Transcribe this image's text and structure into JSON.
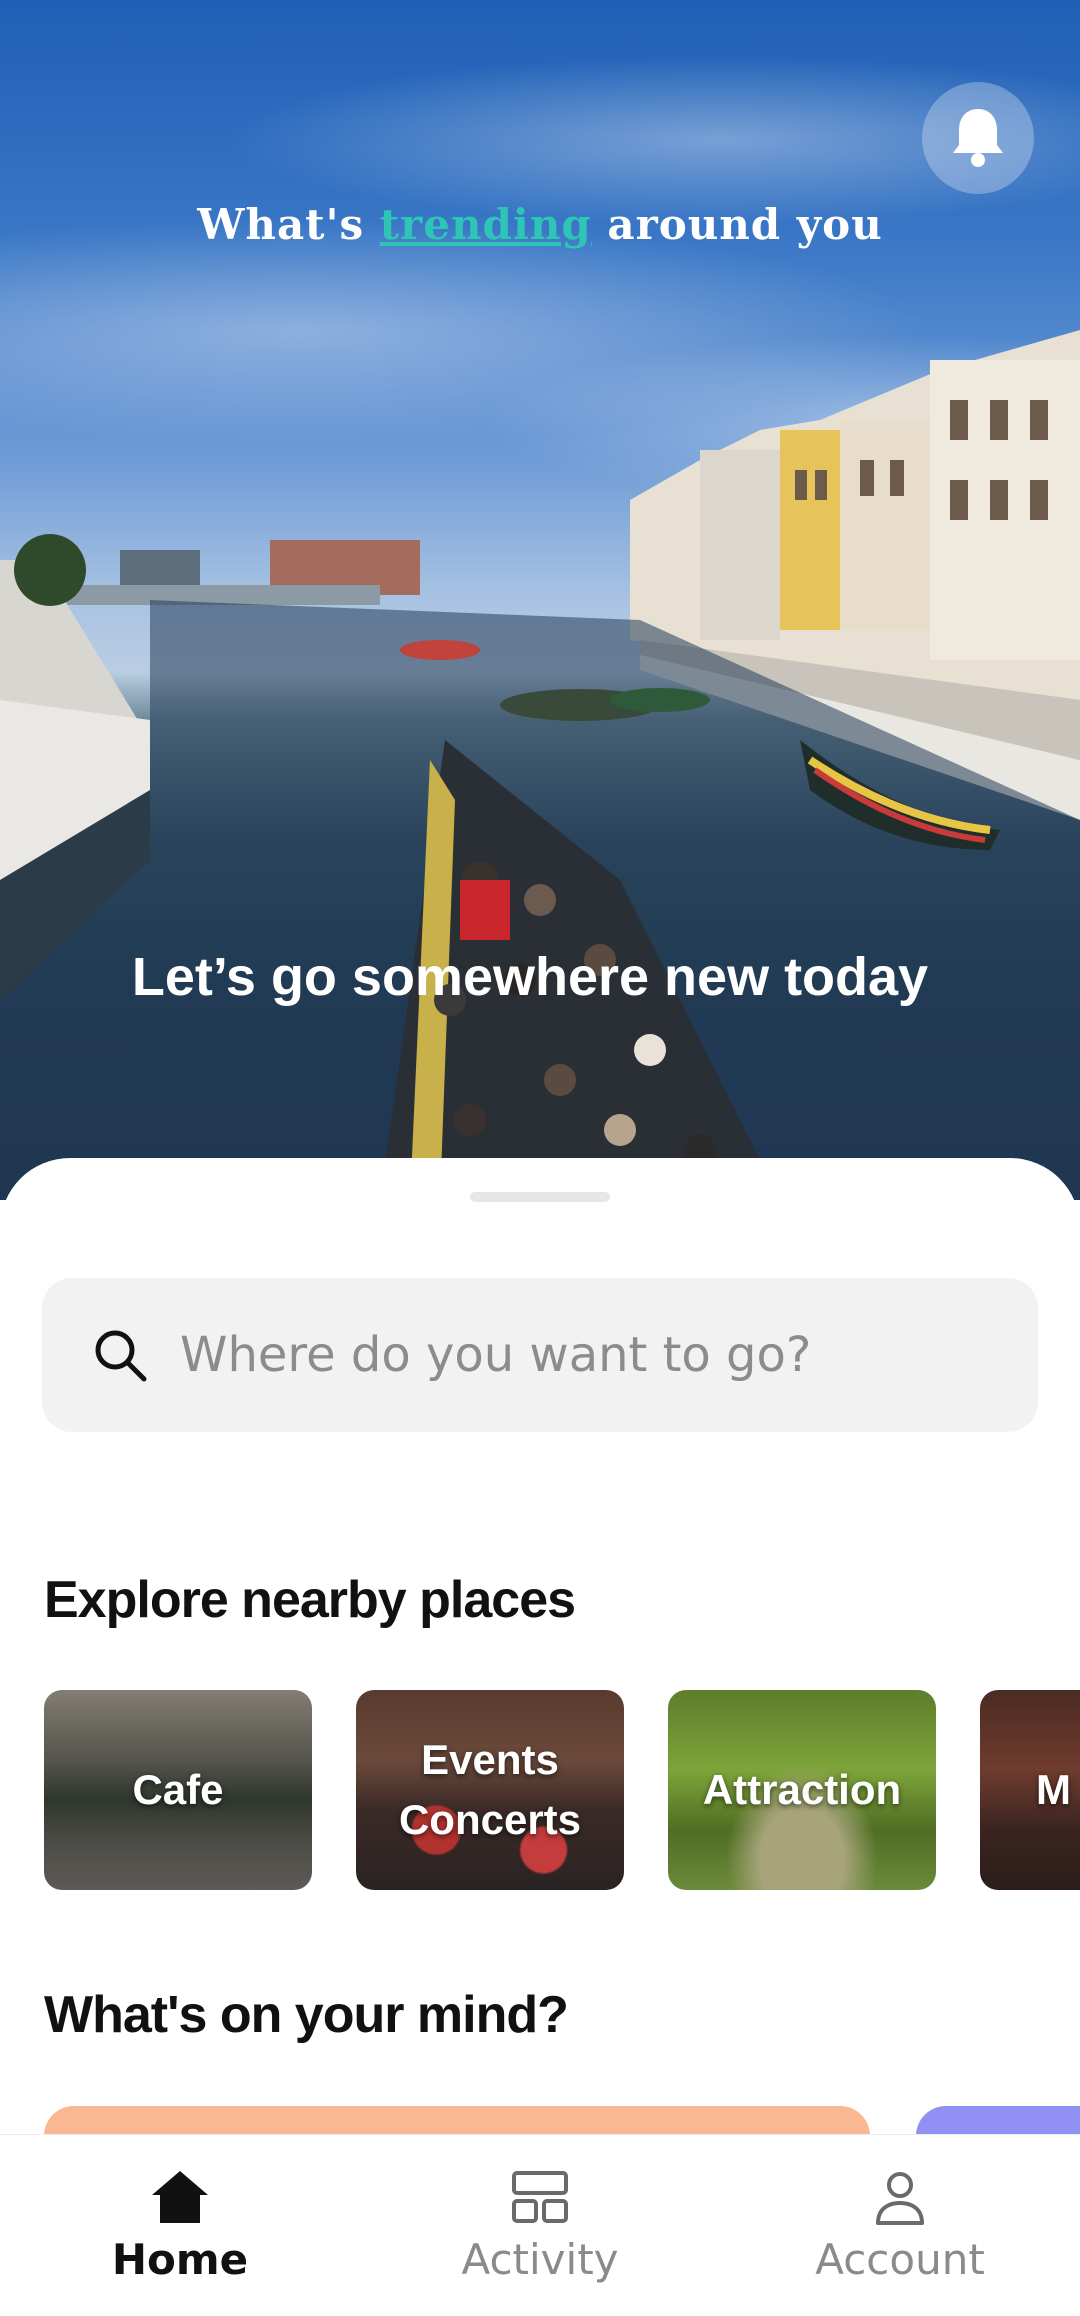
{
  "hero": {
    "title_prefix": "What's ",
    "title_highlight": "trending",
    "title_suffix": " around you",
    "tagline": "Let’s go somewhere new today",
    "notification_icon": "bell-icon"
  },
  "search": {
    "placeholder": "Where do you want to go?",
    "icon": "search-icon"
  },
  "explore": {
    "title": "Explore nearby places",
    "categories": [
      {
        "label": "Cafe"
      },
      {
        "label": "Events\nConcerts"
      },
      {
        "label": "Attraction"
      },
      {
        "label": "M"
      }
    ]
  },
  "mind": {
    "title": "What's on your mind?",
    "colors": [
      "#f9b892",
      "#9090f5"
    ]
  },
  "nav": {
    "items": [
      {
        "label": "Home",
        "icon": "home-icon",
        "active": true
      },
      {
        "label": "Activity",
        "icon": "activity-icon",
        "active": false
      },
      {
        "label": "Account",
        "icon": "account-icon",
        "active": false
      }
    ]
  },
  "colors": {
    "accent": "#2ec4b6",
    "text": "#111111",
    "muted": "#8a8a8a"
  }
}
